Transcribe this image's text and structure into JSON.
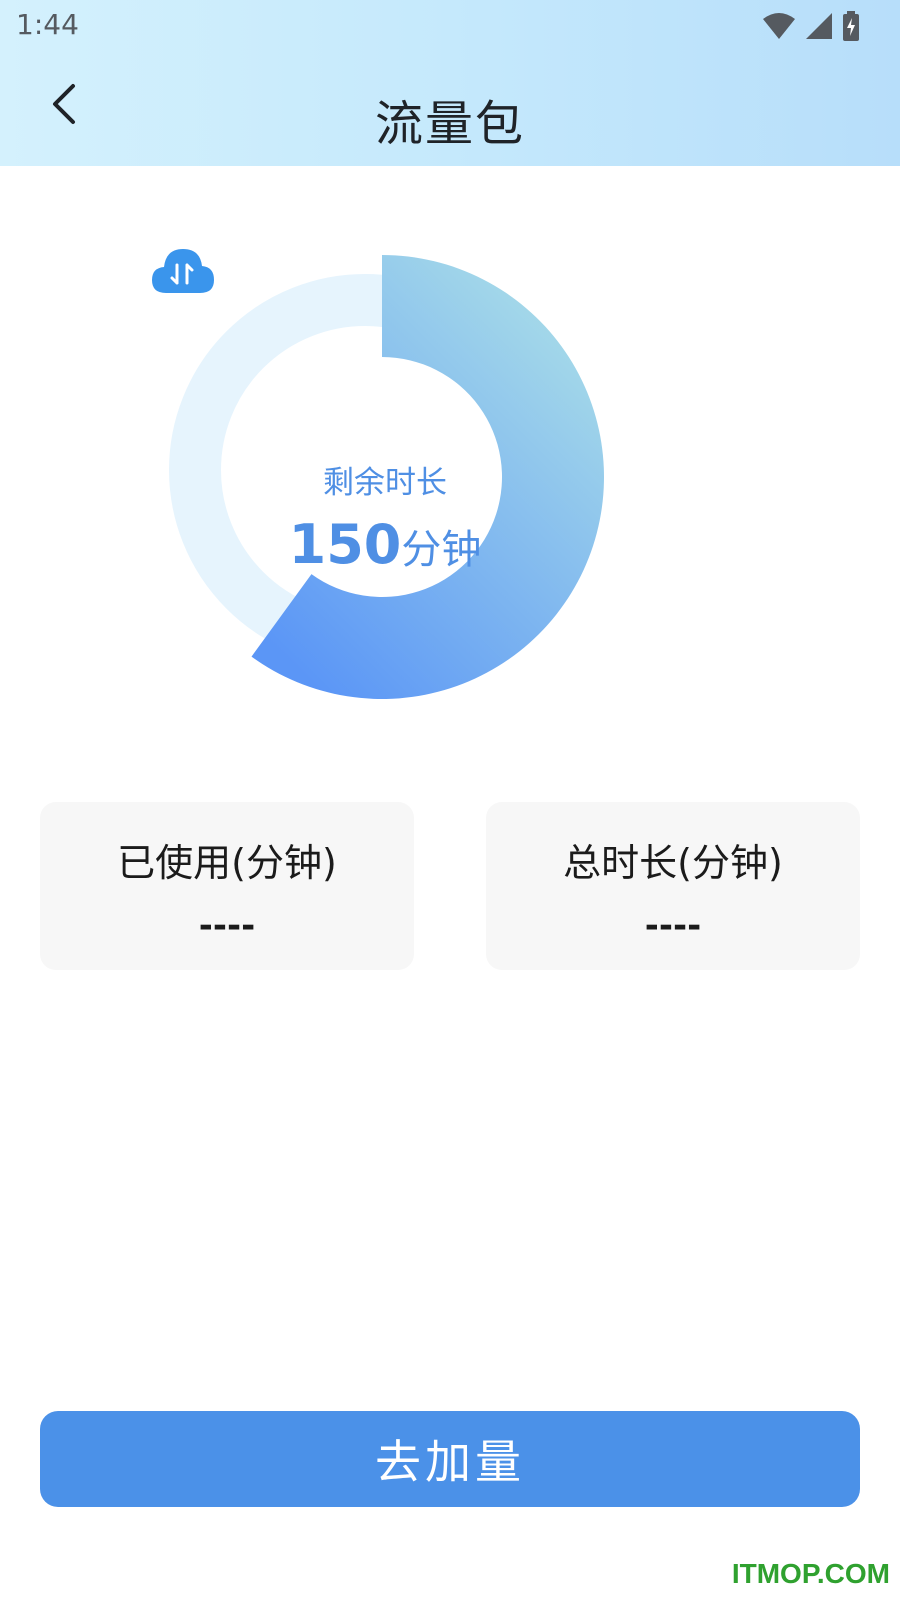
{
  "status_bar": {
    "time": "1:44",
    "icons": [
      "wifi-icon",
      "signal-icon",
      "battery-charging-icon"
    ]
  },
  "header": {
    "back_icon": "chevron-left-icon",
    "title": "流量包"
  },
  "usage_ring": {
    "remaining_fraction": 0.6,
    "icon": "cloud-transfer-icon",
    "label": "剩余时长",
    "value": "150",
    "unit": "分钟"
  },
  "stats": {
    "used": {
      "label": "已使用(分钟)",
      "value": "----"
    },
    "total": {
      "label": "总时长(分钟)",
      "value": "----"
    }
  },
  "actions": {
    "add_label": "去加量"
  },
  "watermark": "ITMOP.COM",
  "colors": {
    "accent": "#4b91e8",
    "ring_track": "#e6f4fd",
    "ring_start": "#5b96f6",
    "ring_end": "#a9dde8",
    "text_blue": "#4f8fe4",
    "watermark": "#2fa12f"
  }
}
